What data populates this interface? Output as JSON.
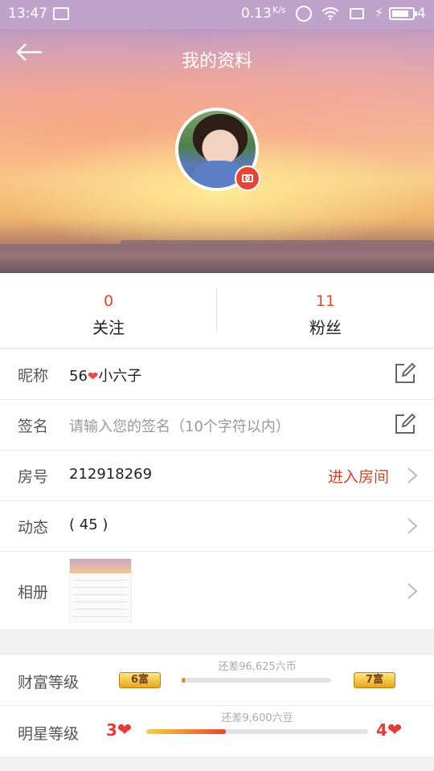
{
  "status_bar": {
    "time": "13:47",
    "net_speed": "0.13",
    "net_unit": "K/s",
    "battery_level": "4"
  },
  "header": {
    "title": "我的资料"
  },
  "stats": {
    "following": {
      "count": "0",
      "label": "关注"
    },
    "fans": {
      "count": "11",
      "label": "粉丝"
    }
  },
  "profile": {
    "nickname": {
      "label": "昵称",
      "value_prefix": "56",
      "heart": "❤",
      "value_suffix": "小六子"
    },
    "signature": {
      "label": "签名",
      "placeholder": "请输入您的签名（10个字符以内）"
    },
    "room": {
      "label": "房号",
      "value": "212918269",
      "action": "进入房间"
    },
    "moments": {
      "label": "动态",
      "value": "( 45 )"
    },
    "album": {
      "label": "相册"
    }
  },
  "levels": {
    "wealth": {
      "label": "财富等级",
      "current": "6富",
      "next": "7富",
      "hint": "还差96,625六币",
      "progress": 0.02
    },
    "star": {
      "label": "明星等级",
      "current": "3",
      "next": "4",
      "hint": "还差9,600六豆",
      "progress": 0.36
    }
  },
  "colors": {
    "accent": "#c9462c",
    "stat_number": "#d0502e",
    "heart": "#e63a3a"
  }
}
